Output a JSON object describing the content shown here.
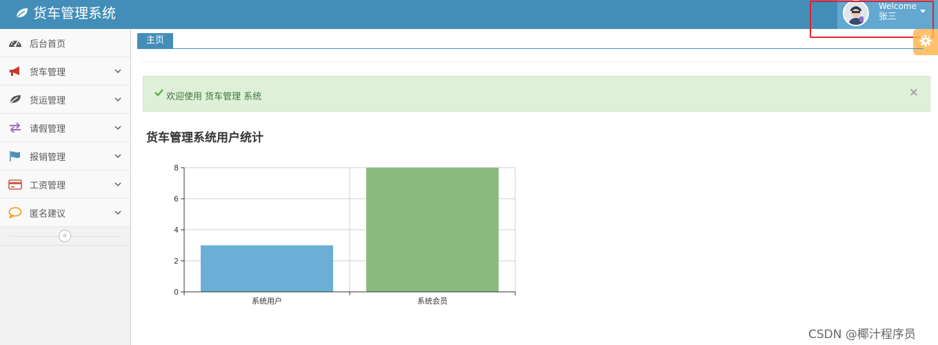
{
  "app": {
    "title": "货车管理系统"
  },
  "user": {
    "welcome": "Welcome",
    "name": "张三"
  },
  "sidebar": {
    "items": [
      {
        "label": "后台首页",
        "icon": "dashboard-icon",
        "expandable": false,
        "color": "#555555"
      },
      {
        "label": "货车管理",
        "icon": "bullhorn-icon",
        "expandable": true,
        "color": "#d15b47"
      },
      {
        "label": "货运管理",
        "icon": "leaf-icon",
        "expandable": true,
        "color": "#555555"
      },
      {
        "label": "请假管理",
        "icon": "exchange-icon",
        "expandable": true,
        "color": "#a069c3"
      },
      {
        "label": "报销管理",
        "icon": "flag-icon",
        "expandable": true,
        "color": "#4c8fbd"
      },
      {
        "label": "工资管理",
        "icon": "credit-card-icon",
        "expandable": true,
        "color": "#d15b47"
      },
      {
        "label": "匿名建议",
        "icon": "comment-icon",
        "expandable": true,
        "color": "#f89406"
      }
    ]
  },
  "tabs": [
    {
      "label": "主页",
      "active": true
    }
  ],
  "alert": {
    "text": "欢迎使用 货车管理 系统",
    "close": "×"
  },
  "chart_section": {
    "heading": "货车管理系统用户统计"
  },
  "chart_data": {
    "type": "bar",
    "categories": [
      "系统用户",
      "系统会员"
    ],
    "values": [
      3,
      8
    ],
    "colors": [
      "#6baed6",
      "#8aba7e"
    ],
    "ylim": [
      0,
      8
    ],
    "yticks": [
      0,
      2,
      4,
      6,
      8
    ],
    "grid": true
  },
  "watermark": "CSDN @椰汁程序员",
  "colors": {
    "navbar": "#438eb9",
    "user_box": "#62a8d1",
    "alert_bg": "#dff0d8",
    "settings": "#ffb752"
  }
}
